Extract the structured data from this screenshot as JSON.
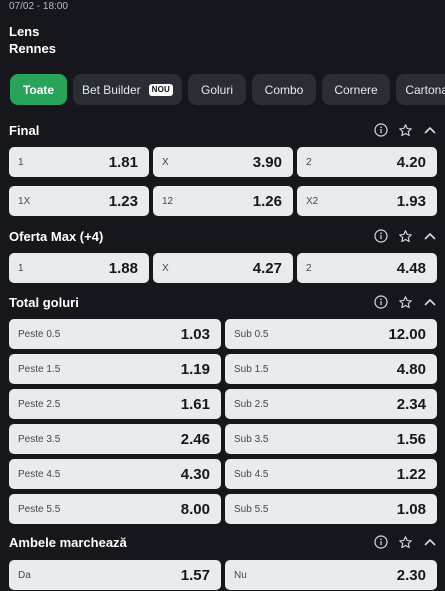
{
  "match": {
    "datetime": "07/02 - 18:00",
    "home": "Lens",
    "away": "Rennes"
  },
  "tabs": [
    {
      "label": "Toate",
      "active": true
    },
    {
      "label": "Bet Builder",
      "badge": "NOU"
    },
    {
      "label": "Goluri"
    },
    {
      "label": "Combo"
    },
    {
      "label": "Cornere"
    },
    {
      "label": "Cartonașe"
    }
  ],
  "icons": {
    "info": "info-icon",
    "favorite": "star-icon",
    "collapse": "chevron-up-icon"
  },
  "colors": {
    "accent": "#27a35a",
    "background": "#15171c",
    "tab_bg": "#2a2d34",
    "odd_bg": "#e9ebef"
  },
  "markets": [
    {
      "title": "Final",
      "rows": [
        [
          {
            "label": "1",
            "odd": "1.81"
          },
          {
            "label": "X",
            "odd": "3.90"
          },
          {
            "label": "2",
            "odd": "4.20"
          }
        ],
        [
          {
            "label": "1X",
            "odd": "1.23"
          },
          {
            "label": "12",
            "odd": "1.26"
          },
          {
            "label": "X2",
            "odd": "1.93"
          }
        ]
      ]
    },
    {
      "title": "Oferta Max (+4)",
      "rows": [
        [
          {
            "label": "1",
            "odd": "1.88"
          },
          {
            "label": "X",
            "odd": "4.27"
          },
          {
            "label": "2",
            "odd": "4.48"
          }
        ]
      ]
    },
    {
      "title": "Total goluri",
      "rows": [
        [
          {
            "label": "Peste 0.5",
            "odd": "1.03"
          },
          {
            "label": "Sub 0.5",
            "odd": "12.00"
          }
        ],
        [
          {
            "label": "Peste 1.5",
            "odd": "1.19"
          },
          {
            "label": "Sub 1.5",
            "odd": "4.80"
          }
        ],
        [
          {
            "label": "Peste 2.5",
            "odd": "1.61"
          },
          {
            "label": "Sub 2.5",
            "odd": "2.34"
          }
        ],
        [
          {
            "label": "Peste 3.5",
            "odd": "2.46"
          },
          {
            "label": "Sub 3.5",
            "odd": "1.56"
          }
        ],
        [
          {
            "label": "Peste 4.5",
            "odd": "4.30"
          },
          {
            "label": "Sub 4.5",
            "odd": "1.22"
          }
        ],
        [
          {
            "label": "Peste 5.5",
            "odd": "8.00"
          },
          {
            "label": "Sub 5.5",
            "odd": "1.08"
          }
        ]
      ]
    },
    {
      "title": "Ambele marchează",
      "rows": [
        [
          {
            "label": "Da",
            "odd": "1.57"
          },
          {
            "label": "Nu",
            "odd": "2.30"
          }
        ]
      ]
    }
  ]
}
